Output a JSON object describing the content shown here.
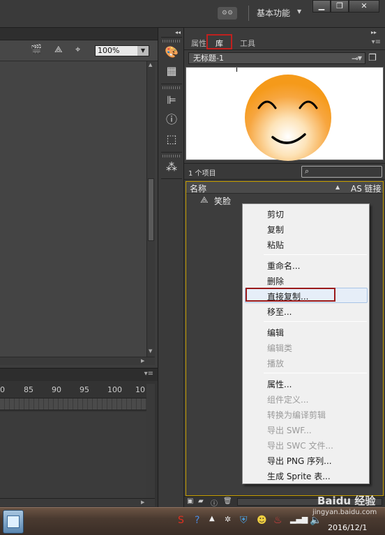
{
  "titlebar": {
    "workspace_label": "基本功能"
  },
  "stage": {
    "zoom": "100%"
  },
  "timeline": {
    "ruler_ticks": [
      "0",
      "85",
      "90",
      "95",
      "100",
      "10"
    ]
  },
  "library": {
    "tabs": [
      "属性",
      "库",
      "工具"
    ],
    "document": "无标题-1",
    "item_count": "1 个项目",
    "col_name": "名称",
    "col_linkage": "AS 链接",
    "items": [
      {
        "label": "笑脸"
      }
    ]
  },
  "context_menu": {
    "items": [
      {
        "label": "剪切",
        "enabled": true
      },
      {
        "label": "复制",
        "enabled": true
      },
      {
        "label": "粘贴",
        "enabled": true
      },
      {
        "label": "重命名...",
        "enabled": true
      },
      {
        "label": "删除",
        "enabled": true
      },
      {
        "label": "直接复制...",
        "enabled": true
      },
      {
        "label": "移至...",
        "enabled": true
      },
      {
        "label": "编辑",
        "enabled": true
      },
      {
        "label": "编辑类",
        "enabled": false
      },
      {
        "label": "播放",
        "enabled": false
      },
      {
        "label": "属性...",
        "enabled": true
      },
      {
        "label": "组件定义...",
        "enabled": false
      },
      {
        "label": "转换为编译剪辑",
        "enabled": false
      },
      {
        "label": "导出 SWF...",
        "enabled": false
      },
      {
        "label": "导出 SWC 文件...",
        "enabled": false
      },
      {
        "label": "导出 PNG 序列...",
        "enabled": true
      },
      {
        "label": "生成 Sprite 表...",
        "enabled": true
      }
    ]
  },
  "taskbar": {
    "date": "2016/12/1",
    "watermark": "Baidu 经验",
    "watermark_sub": "jingyan.baidu.com"
  },
  "colors": {
    "highlight_red": "#c0211f",
    "smiley_orange": "#f59a1a"
  }
}
